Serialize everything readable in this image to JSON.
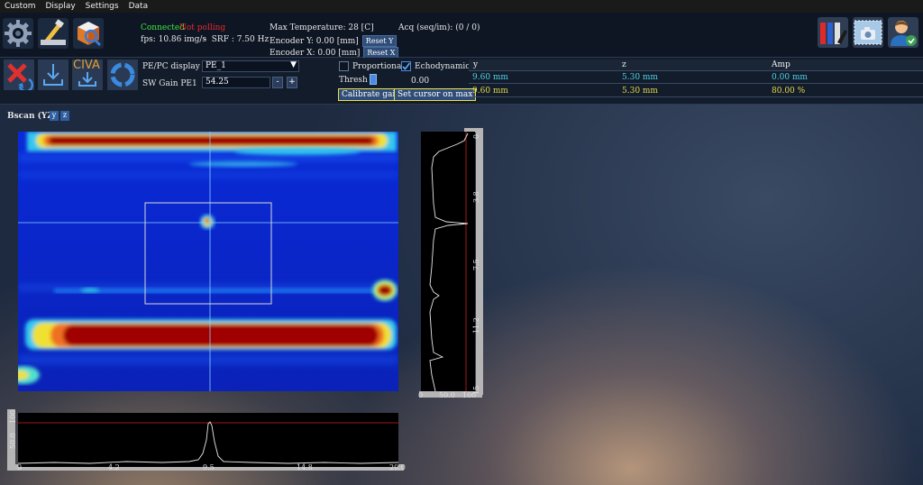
{
  "menu": [
    "Custom",
    "Display",
    "Settings",
    "Data"
  ],
  "status": {
    "connected": "Connected",
    "polling": "Not polling",
    "fps": "fps: 10.86 img/s",
    "srf": "SRF : 7.50 Hz",
    "max_temperature": "Max Temperature: 28 [C]",
    "encoder_y": "Encoder Y: 0.00 [mm]",
    "encoder_x": "Encoder X: 0.00 [mm]",
    "reset_y": "Reset Y",
    "reset_x": "Reset X",
    "acq": "Acq (seq/im): (0 / 0)"
  },
  "controls": {
    "pe_pc_label": "PE/PC display",
    "pe_pc_value": "PE_1",
    "sw_gain_label": "SW Gain PE1",
    "sw_gain_value": "54.25",
    "minus": "-",
    "plus": "+",
    "proportional": "Proportional",
    "echodynamic": "Echodynamic",
    "thresh_label": "Thresh :",
    "thresh_value": "0.00",
    "calibrate_gain": "Calibrate gain",
    "set_cursor": "Set cursor on max",
    "civa_label": "CIVA"
  },
  "cursor_table": {
    "headers": [
      "y",
      "z",
      "Amp"
    ],
    "rows": [
      [
        "9.60 mm",
        "5.30 mm",
        "0.00 mm"
      ],
      [
        "9.60 mm",
        "5.30 mm",
        "80.00 %"
      ]
    ],
    "row_colors": [
      "#4fd3e6",
      "#e6d84a"
    ]
  },
  "bscan": {
    "title": "Bscan (YZ)",
    "axis_y": "y",
    "axis_z": "z"
  },
  "ascan_right": {
    "ticks_z": [
      "3.8",
      "7.5",
      "11.2"
    ],
    "ticks_bottom": [
      "0",
      "50.0",
      "100"
    ],
    "end_labels": [
      "0",
      "15"
    ]
  },
  "ascan_bottom": {
    "ticks_x": [
      "0",
      "4.2",
      "9.5",
      "14.8",
      "20.0"
    ],
    "ticks_y": [
      "50.0",
      "100"
    ]
  },
  "colors": {
    "connected": "#3fe33f",
    "polling": "#e52a2a",
    "accent": "#2f4d78",
    "highlight": "#f0e040"
  }
}
